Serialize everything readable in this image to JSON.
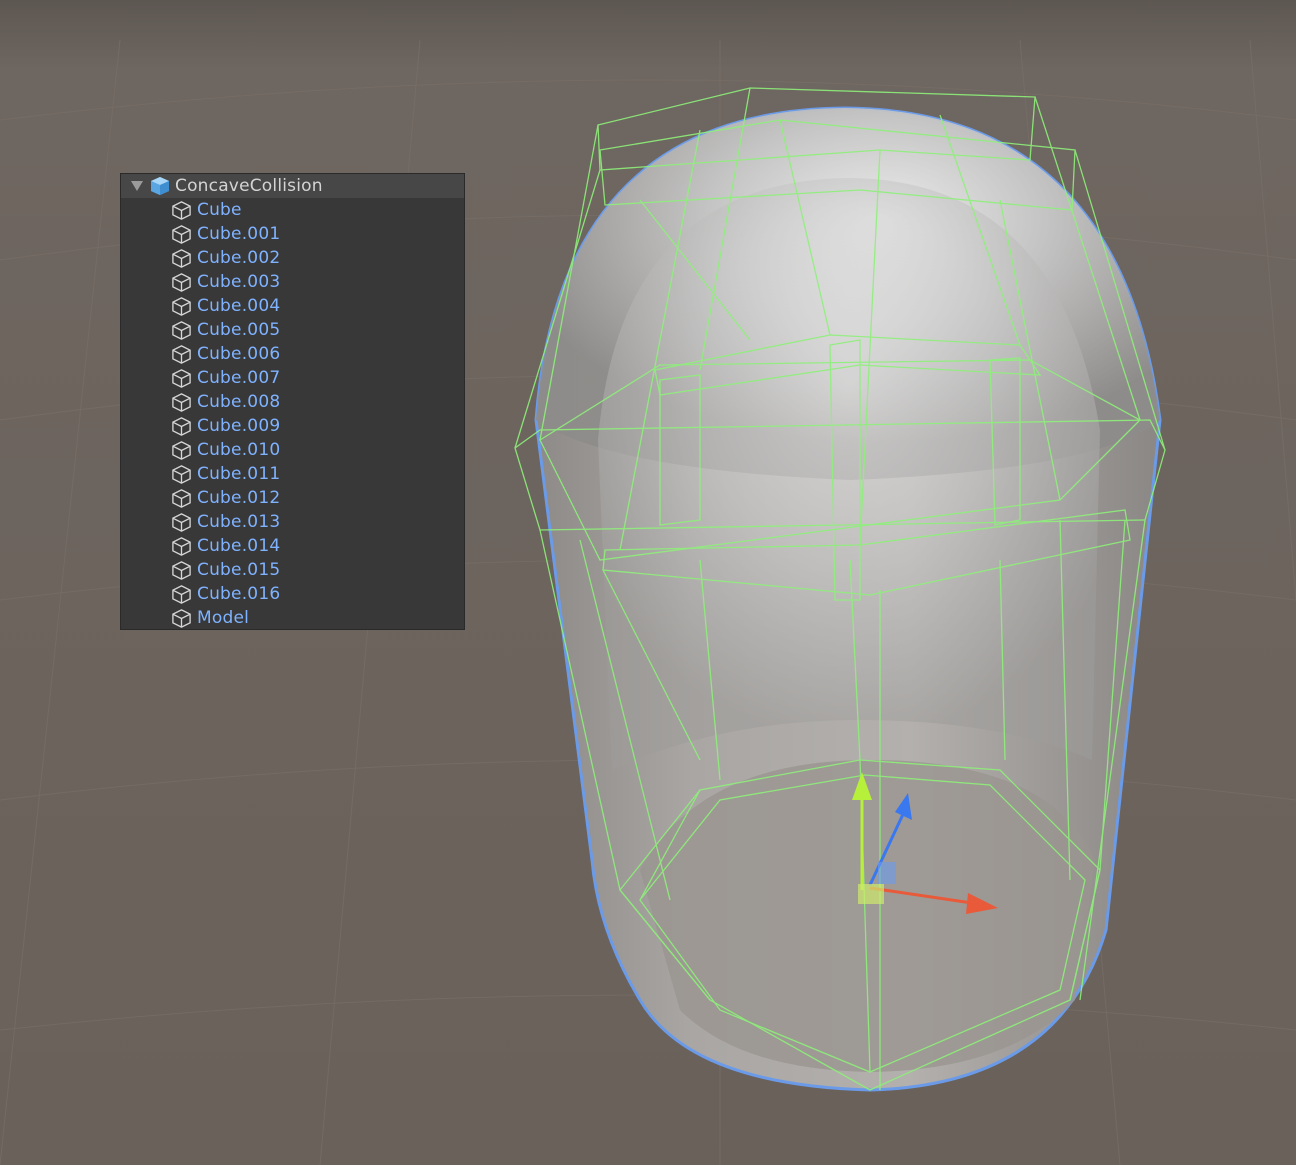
{
  "hierarchy": {
    "root": {
      "label": "ConcaveCollision",
      "icon": "prefab-cube-icon",
      "expanded": true
    },
    "children": [
      {
        "label": "Cube",
        "icon": "cube-icon"
      },
      {
        "label": "Cube.001",
        "icon": "cube-icon"
      },
      {
        "label": "Cube.002",
        "icon": "cube-icon"
      },
      {
        "label": "Cube.003",
        "icon": "cube-icon"
      },
      {
        "label": "Cube.004",
        "icon": "cube-icon"
      },
      {
        "label": "Cube.005",
        "icon": "cube-icon"
      },
      {
        "label": "Cube.006",
        "icon": "cube-icon"
      },
      {
        "label": "Cube.007",
        "icon": "cube-icon"
      },
      {
        "label": "Cube.008",
        "icon": "cube-icon"
      },
      {
        "label": "Cube.009",
        "icon": "cube-icon"
      },
      {
        "label": "Cube.010",
        "icon": "cube-icon"
      },
      {
        "label": "Cube.011",
        "icon": "cube-icon"
      },
      {
        "label": "Cube.012",
        "icon": "cube-icon"
      },
      {
        "label": "Cube.013",
        "icon": "cube-icon"
      },
      {
        "label": "Cube.014",
        "icon": "cube-icon"
      },
      {
        "label": "Cube.015",
        "icon": "cube-icon"
      },
      {
        "label": "Cube.016",
        "icon": "cube-icon"
      },
      {
        "label": "Model",
        "icon": "cube-icon"
      }
    ]
  },
  "colors": {
    "background": "#6b625b",
    "collider_wire": "#8ef07a",
    "selection_outline": "#6b9be8",
    "item_text": "#7fb2ff",
    "root_text": "#d4d4d4",
    "axis_x": "#e85a3a",
    "axis_y": "#b6f03a",
    "axis_z": "#3a78f0"
  }
}
